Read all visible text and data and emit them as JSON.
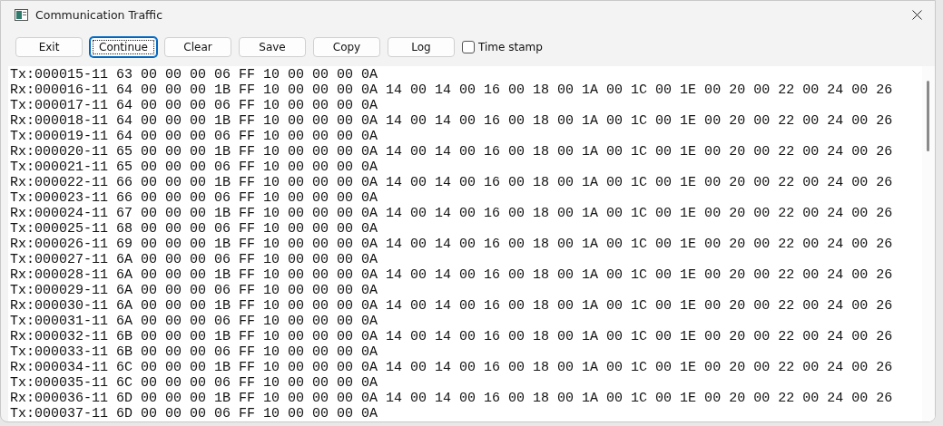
{
  "window": {
    "title": "Communication Traffic"
  },
  "buttons": [
    {
      "label": "Exit",
      "focused": false
    },
    {
      "label": "Continue",
      "focused": true
    },
    {
      "label": "Clear",
      "focused": false
    },
    {
      "label": "Save",
      "focused": false
    },
    {
      "label": "Copy",
      "focused": false
    },
    {
      "label": "Log",
      "focused": false
    }
  ],
  "time_stamp": {
    "label": "Time stamp",
    "checked": false
  },
  "log_lines": [
    "Tx:000015-11 63 00 00 00 06 FF 10 00 00 00 0A",
    "Rx:000016-11 64 00 00 00 1B FF 10 00 00 00 0A 14 00 14 00 16 00 18 00 1A 00 1C 00 1E 00 20 00 22 00 24 00 26",
    "Tx:000017-11 64 00 00 00 06 FF 10 00 00 00 0A",
    "Rx:000018-11 64 00 00 00 1B FF 10 00 00 00 0A 14 00 14 00 16 00 18 00 1A 00 1C 00 1E 00 20 00 22 00 24 00 26",
    "Tx:000019-11 64 00 00 00 06 FF 10 00 00 00 0A",
    "Rx:000020-11 65 00 00 00 1B FF 10 00 00 00 0A 14 00 14 00 16 00 18 00 1A 00 1C 00 1E 00 20 00 22 00 24 00 26",
    "Tx:000021-11 65 00 00 00 06 FF 10 00 00 00 0A",
    "Rx:000022-11 66 00 00 00 1B FF 10 00 00 00 0A 14 00 14 00 16 00 18 00 1A 00 1C 00 1E 00 20 00 22 00 24 00 26",
    "Tx:000023-11 66 00 00 00 06 FF 10 00 00 00 0A",
    "Rx:000024-11 67 00 00 00 1B FF 10 00 00 00 0A 14 00 14 00 16 00 18 00 1A 00 1C 00 1E 00 20 00 22 00 24 00 26",
    "Tx:000025-11 68 00 00 00 06 FF 10 00 00 00 0A",
    "Rx:000026-11 69 00 00 00 1B FF 10 00 00 00 0A 14 00 14 00 16 00 18 00 1A 00 1C 00 1E 00 20 00 22 00 24 00 26",
    "Tx:000027-11 6A 00 00 00 06 FF 10 00 00 00 0A",
    "Rx:000028-11 6A 00 00 00 1B FF 10 00 00 00 0A 14 00 14 00 16 00 18 00 1A 00 1C 00 1E 00 20 00 22 00 24 00 26",
    "Tx:000029-11 6A 00 00 00 06 FF 10 00 00 00 0A",
    "Rx:000030-11 6A 00 00 00 1B FF 10 00 00 00 0A 14 00 14 00 16 00 18 00 1A 00 1C 00 1E 00 20 00 22 00 24 00 26",
    "Tx:000031-11 6A 00 00 00 06 FF 10 00 00 00 0A",
    "Rx:000032-11 6B 00 00 00 1B FF 10 00 00 00 0A 14 00 14 00 16 00 18 00 1A 00 1C 00 1E 00 20 00 22 00 24 00 26",
    "Tx:000033-11 6B 00 00 00 06 FF 10 00 00 00 0A",
    "Rx:000034-11 6C 00 00 00 1B FF 10 00 00 00 0A 14 00 14 00 16 00 18 00 1A 00 1C 00 1E 00 20 00 22 00 24 00 26",
    "Tx:000035-11 6C 00 00 00 06 FF 10 00 00 00 0A",
    "Rx:000036-11 6D 00 00 00 1B FF 10 00 00 00 0A 14 00 14 00 16 00 18 00 1A 00 1C 00 1E 00 20 00 22 00 24 00 26",
    "Tx:000037-11 6D 00 00 00 06 FF 10 00 00 00 0A"
  ]
}
